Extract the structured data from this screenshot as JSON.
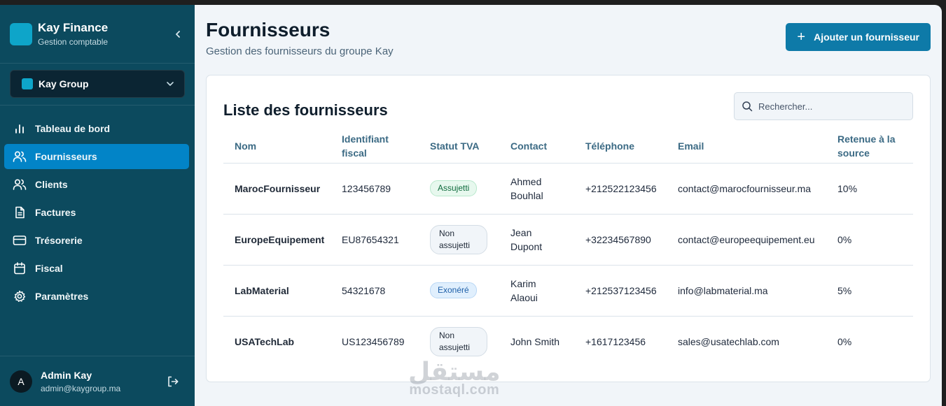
{
  "brand": {
    "title": "Kay Finance",
    "subtitle": "Gestion comptable"
  },
  "org": {
    "name": "Kay Group"
  },
  "nav": [
    {
      "label": "Tableau de bord",
      "icon": "bar-chart-icon",
      "active": false
    },
    {
      "label": "Fournisseurs",
      "icon": "users-icon",
      "active": true
    },
    {
      "label": "Clients",
      "icon": "users-icon",
      "active": false
    },
    {
      "label": "Factures",
      "icon": "file-icon",
      "active": false
    },
    {
      "label": "Trésorerie",
      "icon": "credit-card-icon",
      "active": false
    },
    {
      "label": "Fiscal",
      "icon": "calendar-icon",
      "active": false
    },
    {
      "label": "Paramètres",
      "icon": "gear-icon",
      "active": false
    }
  ],
  "user": {
    "initial": "A",
    "name": "Admin Kay",
    "email": "admin@kaygroup.ma"
  },
  "page": {
    "title": "Fournisseurs",
    "subtitle": "Gestion des fournisseurs du groupe Kay",
    "add_button": "Ajouter un fournisseur"
  },
  "card": {
    "title": "Liste des fournisseurs",
    "search_placeholder": "Rechercher..."
  },
  "table": {
    "columns": [
      "Nom",
      "Identifiant fiscal",
      "Statut TVA",
      "Contact",
      "Téléphone",
      "Email",
      "Retenue à la source"
    ],
    "rows": [
      {
        "name": "MarocFournisseur",
        "tax_id": "123456789",
        "vat": "Assujetti",
        "vat_style": "green",
        "contact": "Ahmed Bouhlal",
        "phone": "+212522123456",
        "email": "contact@marocfournisseur.ma",
        "withholding": "10%"
      },
      {
        "name": "EuropeEquipement",
        "tax_id": "EU87654321",
        "vat": "Non assujetti",
        "vat_style": "gray",
        "contact": "Jean Dupont",
        "phone": "+32234567890",
        "email": "contact@europeequipement.eu",
        "withholding": "0%"
      },
      {
        "name": "LabMaterial",
        "tax_id": "54321678",
        "vat": "Exonéré",
        "vat_style": "blue",
        "contact": "Karim Alaoui",
        "phone": "+212537123456",
        "email": "info@labmaterial.ma",
        "withholding": "5%"
      },
      {
        "name": "USATechLab",
        "tax_id": "US123456789",
        "vat": "Non assujetti",
        "vat_style": "gray",
        "contact": "John Smith",
        "phone": "+1617123456",
        "email": "sales@usatechlab.com",
        "withholding": "0%"
      }
    ]
  },
  "watermark": {
    "arabic": "مستقل",
    "latin": "mostaql.com"
  },
  "colors": {
    "sidebar": "#0c4a5e",
    "accent": "#0284c7",
    "button": "#0e7aa8",
    "page_bg": "#f1f5f9"
  }
}
